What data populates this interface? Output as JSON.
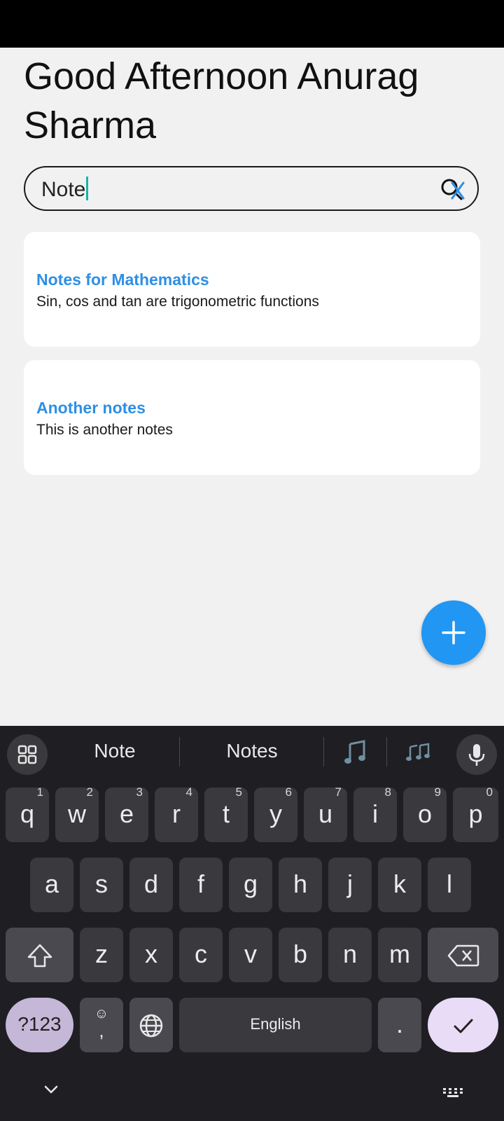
{
  "greeting": "Good Afternoon Anurag Sharma",
  "search": {
    "value": "Note"
  },
  "notes": [
    {
      "title": "Notes for Mathematics",
      "body": "Sin, cos and tan are trigonometric functions"
    },
    {
      "title": "Another notes",
      "body": "This is another notes"
    }
  ],
  "fab": {
    "icon": "plus-icon"
  },
  "colors": {
    "accent": "#2196f3",
    "note_title": "#2e8fe4",
    "caret": "#19b3a8",
    "keyboard_bg": "#1f1e22"
  },
  "keyboard": {
    "suggestions": [
      "Note",
      "Notes"
    ],
    "row1": [
      {
        "k": "q",
        "h": "1"
      },
      {
        "k": "w",
        "h": "2"
      },
      {
        "k": "e",
        "h": "3"
      },
      {
        "k": "r",
        "h": "4"
      },
      {
        "k": "t",
        "h": "5"
      },
      {
        "k": "y",
        "h": "6"
      },
      {
        "k": "u",
        "h": "7"
      },
      {
        "k": "i",
        "h": "8"
      },
      {
        "k": "o",
        "h": "9"
      },
      {
        "k": "p",
        "h": "0"
      }
    ],
    "row2": [
      "a",
      "s",
      "d",
      "f",
      "g",
      "h",
      "j",
      "k",
      "l"
    ],
    "row3": [
      "z",
      "x",
      "c",
      "v",
      "b",
      "n",
      "m"
    ],
    "symbols_label": "?123",
    "space_label": "English",
    "period_label": ".",
    "comma_label": ","
  }
}
